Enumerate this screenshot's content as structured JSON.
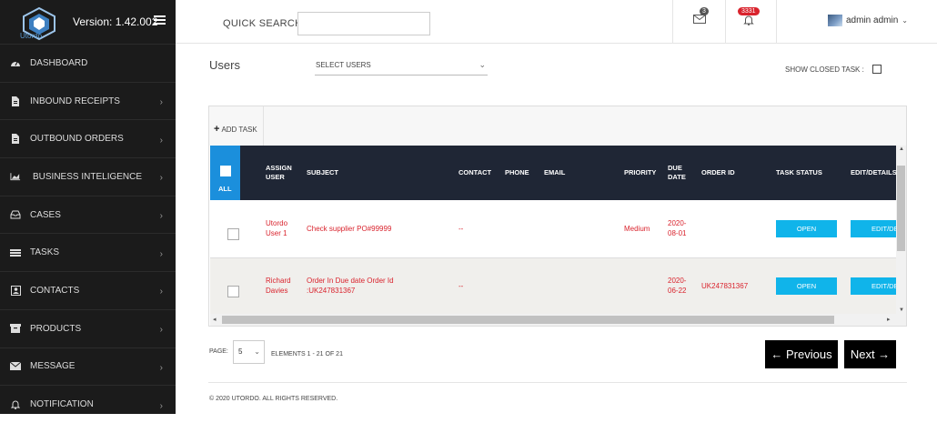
{
  "app": {
    "logo_text": "Utordo",
    "version": "Version: 1.42.002"
  },
  "sidebar": {
    "items": [
      {
        "label": "DASHBOARD",
        "icon": "dashboard-icon"
      },
      {
        "label": "INBOUND RECEIPTS",
        "icon": "document-icon"
      },
      {
        "label": "OUTBOUND ORDERS",
        "icon": "document-icon"
      },
      {
        "label": "BUSINESS INTELIGENCE",
        "icon": "area-chart-icon"
      },
      {
        "label": "CASES",
        "icon": "inbox-icon"
      },
      {
        "label": "TASKS",
        "icon": "list-icon"
      },
      {
        "label": "CONTACTS",
        "icon": "contact-card-icon"
      },
      {
        "label": "PRODUCTS",
        "icon": "archive-icon"
      },
      {
        "label": "MESSAGE",
        "icon": "envelope-icon"
      },
      {
        "label": "NOTIFICATION",
        "icon": "bell-icon"
      }
    ]
  },
  "header": {
    "quick_search_label": "QUICK SEARCH :",
    "quick_search_value": "",
    "mail_count": "3",
    "notification_count": "3331",
    "user_name": "admin admin"
  },
  "filters": {
    "title": "Users",
    "select_users": "SELECT USERS",
    "show_closed_label": "SHOW CLOSED TASK :"
  },
  "table": {
    "add_task": "ADD TASK",
    "all_label": "ALL",
    "columns": {
      "assign_user": "ASSIGN USER",
      "subject": "SUBJECT",
      "contact": "CONTACT",
      "phone": "PHONE",
      "email": "EMAIL",
      "priority": "PRIORITY",
      "due_date": "DUE DATE",
      "order_id": "ORDER ID",
      "task_status": "TASK STATUS",
      "edit_details": "EDIT/DETAILS"
    },
    "rows": [
      {
        "user": "Utordo User 1",
        "subject": "Check supplier PO#99999",
        "contact": "--",
        "phone": "",
        "email": "",
        "priority": "Medium",
        "due_date": "2020-08-01",
        "order_id": "",
        "status": "OPEN",
        "edit": "EDIT/DETAILS"
      },
      {
        "user": "Richard Davies",
        "subject": "Order In Due date Order Id :UK247831367",
        "contact": "--",
        "phone": "",
        "email": "",
        "priority": "",
        "due_date": "2020-06-22",
        "order_id": "UK247831367",
        "status": "OPEN",
        "edit": "EDIT/DETAILS"
      }
    ]
  },
  "pagination": {
    "page_label": "PAGE:",
    "page_size": "5",
    "elements_text": "ELEMENTS 1 - 21 OF 21",
    "prev_label": "← Previous",
    "next_label": "Next →"
  },
  "footer": {
    "copyright": "© 2020 UTORDO. ALL RIGHTS RESERVED."
  },
  "colors": {
    "sidebar_bg": "#1b1b1b",
    "table_header_bg": "#1f2635",
    "accent_blue": "#10b4ea",
    "all_box_blue": "#1b8fdc",
    "text_red": "#d9232d"
  }
}
